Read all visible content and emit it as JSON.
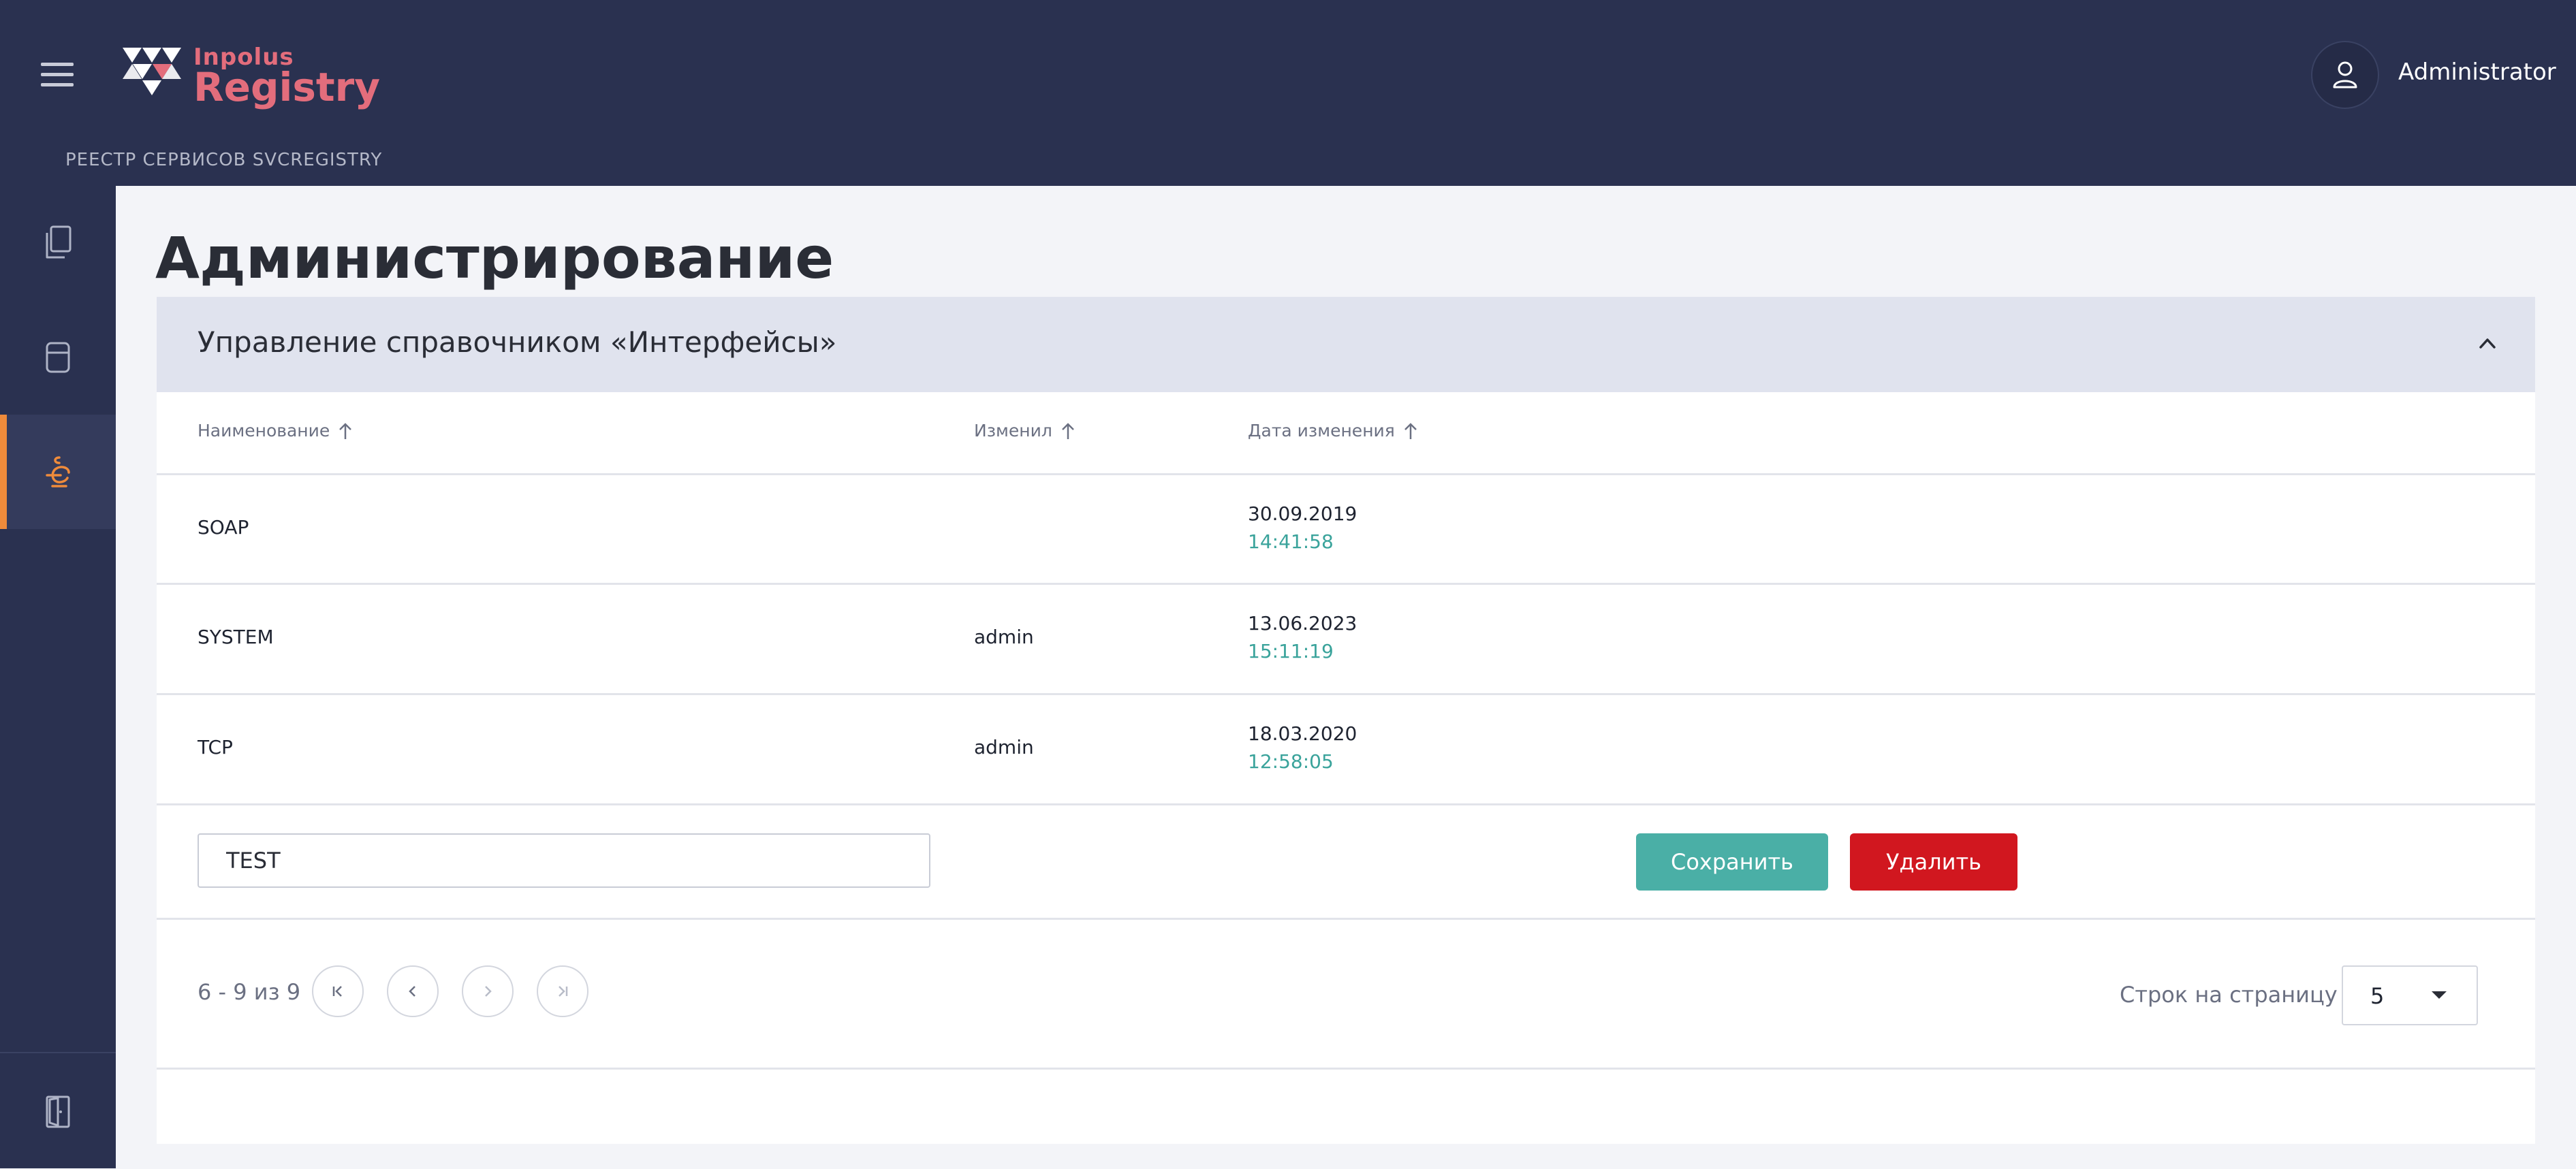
{
  "header": {
    "logo_small": "Inpolus",
    "logo_main": "Registry",
    "breadcrumb": "РЕЕСТР СЕРВИСОВ SVCREGISTRY",
    "user_name": "Administrator"
  },
  "page": {
    "title": "Администрирование"
  },
  "panel": {
    "title": "Управление справочником «Интерфейсы»",
    "columns": [
      "Наименование",
      "Изменил",
      "Дата изменения"
    ],
    "rows": [
      {
        "name": "SOAP",
        "changed_by": "",
        "date": "30.09.2019",
        "time": "14:41:58"
      },
      {
        "name": "SYSTEM",
        "changed_by": "admin",
        "date": "13.06.2023",
        "time": "15:11:19"
      },
      {
        "name": "TCP",
        "changed_by": "admin",
        "date": "18.03.2020",
        "time": "12:58:05"
      }
    ],
    "edit": {
      "value": "TEST",
      "save_label": "Сохранить",
      "delete_label": "Удалить"
    },
    "pagination": {
      "range_text": "6 - 9 из 9",
      "rows_per_page_label": "Строк на страницу",
      "rows_per_page_value": "5"
    }
  },
  "colors": {
    "header_bg": "#2a3150",
    "accent_orange": "#ef8b3b",
    "brand_red": "#e36d7c",
    "teal": "#4aafa6",
    "danger": "#d1171f",
    "time_teal": "#3aa39b"
  },
  "icons": {
    "sidebar": [
      "documents-icon",
      "database-icon",
      "admin-settings-icon",
      "logout-icon"
    ],
    "header": [
      "menu-icon",
      "user-icon"
    ]
  }
}
